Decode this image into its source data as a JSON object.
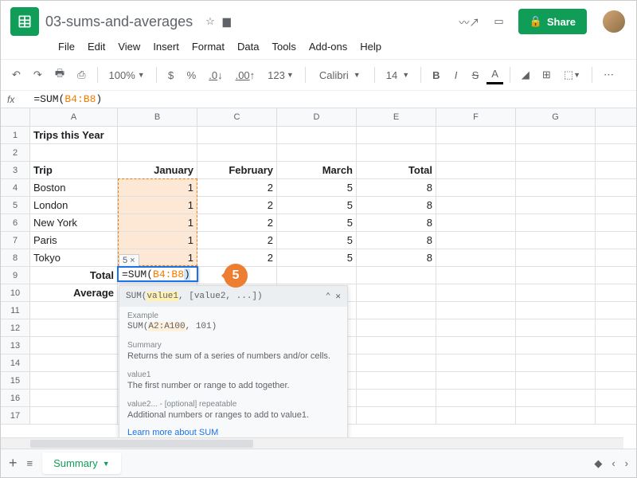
{
  "doc": {
    "title": "03-sums-and-averages"
  },
  "menus": [
    "File",
    "Edit",
    "View",
    "Insert",
    "Format",
    "Data",
    "Tools",
    "Add-ons",
    "Help"
  ],
  "share": "Share",
  "toolbar": {
    "zoom": "100%",
    "font": "Calibri",
    "size": "14",
    "currency": "$",
    "percent": "%",
    "dec_dec": ".0",
    "dec_inc": ".00",
    "numfmt": "123"
  },
  "fx": {
    "label": "fx",
    "prefix": "=SUM(",
    "range": "B4:B8",
    "suffix": ")"
  },
  "cols": [
    "A",
    "B",
    "C",
    "D",
    "E",
    "F",
    "G"
  ],
  "rows": {
    "1": {
      "A": "Trips this Year"
    },
    "3": {
      "A": "Trip",
      "B": "January",
      "C": "February",
      "D": "March",
      "E": "Total"
    },
    "4": {
      "A": "Boston",
      "B": "1",
      "C": "2",
      "D": "5",
      "E": "8"
    },
    "5": {
      "A": "London",
      "B": "1",
      "C": "2",
      "D": "5",
      "E": "8"
    },
    "6": {
      "A": "New York",
      "B": "1",
      "C": "2",
      "D": "5",
      "E": "8"
    },
    "7": {
      "A": "Paris",
      "B": "1",
      "C": "2",
      "D": "5",
      "E": "8"
    },
    "8": {
      "A": "Tokyo",
      "B": "1",
      "C": "2",
      "D": "5",
      "E": "8"
    },
    "9": {
      "A": "Total"
    },
    "10": {
      "A": "Average"
    }
  },
  "formula_cell": {
    "prefix": "=SUM(",
    "range": "B4:B8",
    "suffix": ")",
    "result": "5",
    "close": "×"
  },
  "tooltip": {
    "sig": "SUM(",
    "sig_hl": "value1",
    "sig_rest": ", [value2, ...])",
    "example_lbl": "Example",
    "example_prefix": "SUM(",
    "example_hl": "A2:A100",
    "example_rest": ", 101)",
    "summary_lbl": "Summary",
    "summary_txt": "Returns the sum of a series of numbers and/or cells.",
    "v1_lbl": "value1",
    "v1_txt": "The first number or range to add together.",
    "v2_lbl": "value2... - [optional] repeatable",
    "v2_txt": "Additional numbers or ranges to add to value1.",
    "link": "Learn more about SUM"
  },
  "callout": "5",
  "sheet_tab": "Summary"
}
